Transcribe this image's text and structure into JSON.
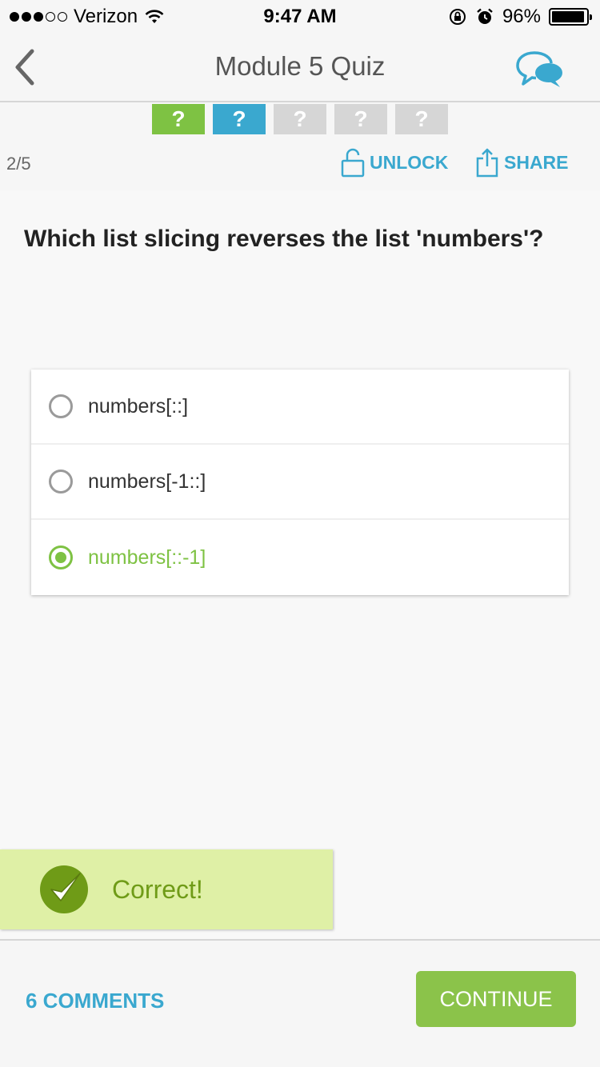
{
  "status_bar": {
    "carrier": "Verizon",
    "time": "9:47 AM",
    "battery_percent": "96%",
    "battery_level": 0.96,
    "signal_bars_filled": 3,
    "signal_bars_total": 5
  },
  "nav": {
    "title": "Module 5 Quiz",
    "back_icon": "chevron-left-icon",
    "chat_icon": "chat-bubbles-icon"
  },
  "progress": {
    "squares": [
      {
        "label": "?",
        "state": "answered"
      },
      {
        "label": "?",
        "state": "current"
      },
      {
        "label": "?",
        "state": "locked"
      },
      {
        "label": "?",
        "state": "locked"
      },
      {
        "label": "?",
        "state": "locked"
      }
    ]
  },
  "toolbar": {
    "counter": "2/5",
    "unlock_label": "UNLOCK",
    "share_label": "SHARE"
  },
  "question": {
    "text": "Which list slicing reverses the list 'numbers'?"
  },
  "options": [
    {
      "text": "numbers[::]",
      "selected": false
    },
    {
      "text": "numbers[-1::]",
      "selected": false
    },
    {
      "text": "numbers[::-1]",
      "selected": true
    }
  ],
  "feedback": {
    "text": "Correct!"
  },
  "footer": {
    "comments_label": "6 COMMENTS",
    "continue_label": "CONTINUE"
  },
  "colors": {
    "accent_blue": "#3aa8cf",
    "correct_green": "#7ec243",
    "continue_green": "#8bc34a",
    "feedback_bg": "#dff0a6"
  }
}
